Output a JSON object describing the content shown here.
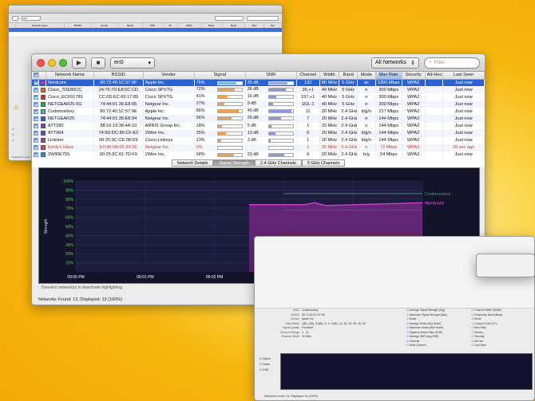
{
  "main": {
    "interface": "en0",
    "network_filter": "All Networks",
    "search_placeholder": "Filter",
    "columns": [
      "",
      "",
      "Network Name",
      "BSSID",
      "Vendor",
      "Signal",
      "SNR",
      "Channel",
      "Width",
      "Band",
      "Mode",
      "Max Rate",
      "Security",
      "Ad-Hoc",
      "Last Seen"
    ],
    "networks": [
      {
        "name": "Nerdcore",
        "bssid": "90:72:40:1C:57:9F",
        "vendor": "Apple Inc.",
        "signal": "76%",
        "signal_level": 0.76,
        "snr": "39 dB",
        "snr_level": 0.78,
        "channel": "132",
        "width": "80 MHz",
        "band": "5 GHz",
        "mode": "ac",
        "max_rate": "1300 Mbps",
        "security": "WPA2",
        "adhoc": "",
        "last_seen": "Just now",
        "color": "#c030c0",
        "selected": true,
        "red": false
      },
      {
        "name": "Cisco_7DE80CC",
        "bssid": "24:76:7D:E8:0C:CD",
        "vendor": "Cisco SPVTG",
        "signal": "72%",
        "signal_level": 0.72,
        "snr": "36 dB",
        "snr_level": 0.72,
        "channel": "36,+1",
        "width": "40 MHz",
        "band": "5 GHz",
        "mode": "n",
        "max_rate": "300 Mbps",
        "security": "WPA2",
        "adhoc": "",
        "last_seen": "Just now",
        "color": "#e07020",
        "selected": false,
        "red": false
      },
      {
        "name": "Cisco_EC691789",
        "bssid": "CC:0D:EC:69:17:89",
        "vendor": "Cisco SPVTG",
        "signal": "41%",
        "signal_level": 0.41,
        "snr": "16 dB",
        "snr_level": 0.32,
        "channel": "157,+1",
        "width": "40 MHz",
        "band": "5 GHz",
        "mode": "n",
        "max_rate": "300 Mbps",
        "security": "WPA2",
        "adhoc": "",
        "last_seen": "Just now",
        "color": "#d03030",
        "selected": false,
        "red": false
      },
      {
        "name": "NETGEAR25-5G",
        "bssid": "74:44:01:36:E8:95",
        "vendor": "Netgear Inc.",
        "signal": "27%",
        "signal_level": 0.27,
        "snr": "9 dB",
        "snr_level": 0.18,
        "channel": "153,-1",
        "width": "40 MHz",
        "band": "5 GHz",
        "mode": "n",
        "max_rate": "300 Mbps",
        "security": "WPA2",
        "adhoc": "",
        "last_seen": "Just now",
        "color": "#30a040",
        "selected": false,
        "red": false
      },
      {
        "name": "Codemonkey",
        "bssid": "90:72:40:1C:57:9E",
        "vendor": "Apple Inc.",
        "signal": "86%",
        "signal_level": 0.86,
        "snr": "49 dB",
        "snr_level": 0.95,
        "channel": "11",
        "width": "20 MHz",
        "band": "2.4 GHz",
        "mode": "b/g/n",
        "max_rate": "217 Mbps",
        "security": "WPA2",
        "adhoc": "",
        "last_seen": "Just now",
        "color": "#40c0a0",
        "selected": false,
        "red": false
      },
      {
        "name": "NETGEAR25",
        "bssid": "74:44:01:36:E8:94",
        "vendor": "Netgear Inc.",
        "signal": "56%",
        "signal_level": 0.56,
        "snr": "25 dB",
        "snr_level": 0.5,
        "channel": "7",
        "width": "20 MHz",
        "band": "2.4 GHz",
        "mode": "n",
        "max_rate": "144 Mbps",
        "security": "WPA2",
        "adhoc": "",
        "last_seen": "Just now",
        "color": "#2060d0",
        "selected": false,
        "red": false
      },
      {
        "name": "ATT280",
        "bssid": "88:16:19:38:4A:10",
        "vendor": "ARRIS Group Inc.",
        "signal": "18%",
        "signal_level": 0.18,
        "snr": "5 dB",
        "snr_level": 0.1,
        "channel": "1",
        "width": "20 MHz",
        "band": "2.4 GHz",
        "mode": "n",
        "max_rate": "144 Mbps",
        "security": "WPA2",
        "adhoc": "",
        "last_seen": "Just now",
        "color": "#8040c0",
        "selected": false,
        "red": false
      },
      {
        "name": "ATT964",
        "bssid": "74:9D:DC:89:CF:E2",
        "vendor": "2Wire Inc.",
        "signal": "35%",
        "signal_level": 0.35,
        "snr": "13 dB",
        "snr_level": 0.26,
        "channel": "6",
        "width": "20 MHz",
        "band": "2.4 GHz",
        "mode": "b/g/n",
        "max_rate": "144 Mbps",
        "security": "WPA2",
        "adhoc": "",
        "last_seen": "Just now",
        "color": "#5050d0",
        "selected": false,
        "red": false
      },
      {
        "name": "Linkster",
        "bssid": "00:25:9C:CE:08:D9",
        "vendor": "Cisco-Linksys",
        "signal": "13%",
        "signal_level": 0.13,
        "snr": "3 dB",
        "snr_level": 0.06,
        "channel": "1",
        "width": "20 MHz",
        "band": "2.4 GHz",
        "mode": "b/g/n",
        "max_rate": "144 Mbps",
        "security": "WPA2",
        "adhoc": "",
        "last_seen": "Just now",
        "color": "#a040a0",
        "selected": false,
        "red": false
      },
      {
        "name": "Emily's Haus",
        "bssid": "E0:46:9A:65:34:2E",
        "vendor": "Netgear Inc.",
        "signal": "0%",
        "signal_level": 0.0,
        "snr": "",
        "snr_level": 0.0,
        "channel": "1",
        "width": "20 MHz",
        "band": "2.4 GHz",
        "mode": "n",
        "max_rate": "72 Mbps",
        "security": "WPA2",
        "adhoc": "",
        "last_seen": "30 sec ago",
        "color": "#d04060",
        "selected": false,
        "red": true
      },
      {
        "name": "2WIRE755",
        "bssid": "00:25:3C:61:7D:F9",
        "vendor": "2Wire Inc.",
        "signal": "68%",
        "signal_level": 0.68,
        "snr": "33 dB",
        "snr_level": 0.66,
        "channel": "6",
        "width": "20 MHz",
        "band": "2.4 GHz",
        "mode": "b/g",
        "max_rate": "54 Mbps",
        "security": "WPA2",
        "adhoc": "",
        "last_seen": "Just now",
        "color": "#3090d0",
        "selected": false,
        "red": false
      }
    ],
    "tabs": [
      "Network Details",
      "Signal Strength",
      "2.4 GHz Channels",
      "5 GHz Channels"
    ],
    "active_tab": "Signal Strength",
    "hint": "Deselect network(s) to deactivate highlighting.",
    "status": "Networks Found: 13, Displayed: 13 (100%)"
  },
  "chart_data": {
    "type": "line",
    "ylabel": "Strength",
    "y_ticks": [
      "100%",
      "90%",
      "80%",
      "70%",
      "60%",
      "50%",
      "40%",
      "30%",
      "20%",
      "10%"
    ],
    "x_ticks": [
      "09:00 PM",
      "09:01 PM",
      "09:02 PM",
      "09:03 PM",
      "09:04 PM",
      "Now"
    ],
    "ylim": [
      0,
      100
    ],
    "legend_visible": [
      "Codemonkey",
      "Nerdcore"
    ],
    "highlighted_series": "Nerdcore",
    "series": [
      {
        "name": "Codemonkey",
        "color": "#5e8a8a",
        "points": [
          [
            3.0,
            86
          ],
          [
            5.0,
            86
          ]
        ]
      },
      {
        "name": "Nerdcore",
        "color": "#d040d0",
        "points": [
          [
            2.5,
            74
          ],
          [
            3.3,
            74
          ],
          [
            3.45,
            76
          ],
          [
            3.6,
            73
          ],
          [
            5.0,
            76
          ]
        ]
      },
      {
        "name": "2WIRE755",
        "color": "#3a6a8a",
        "points": [
          [
            3.0,
            68
          ],
          [
            5.0,
            68
          ]
        ]
      },
      {
        "name": "NETGEAR25",
        "color": "#35508a",
        "points": [
          [
            3.0,
            56
          ],
          [
            5.0,
            56
          ]
        ]
      },
      {
        "name": "Cisco_EC691789",
        "color": "#8a3040",
        "points": [
          [
            3.0,
            41
          ],
          [
            5.0,
            41
          ]
        ]
      },
      {
        "name": "ATT964",
        "color": "#40407a",
        "points": [
          [
            3.0,
            35
          ],
          [
            5.0,
            35
          ]
        ]
      },
      {
        "name": "NETGEAR25-5G",
        "color": "#3a6a3a",
        "points": [
          [
            3.0,
            27
          ],
          [
            5.0,
            27
          ]
        ]
      },
      {
        "name": "ATT280",
        "color": "#5a3a8a",
        "points": [
          [
            3.0,
            18
          ],
          [
            5.0,
            18
          ]
        ]
      }
    ]
  },
  "back_window": {
    "interface": "en0",
    "footer": "Networks Found: 13, Displayed: 13 (100%)"
  },
  "front_window": {
    "fields": [
      {
        "k": "SSID",
        "v": "Codemonkey"
      },
      {
        "k": "BSSID",
        "v": "90:72:40:1C:57:9E"
      },
      {
        "k": "Vendor",
        "v": "Apple Inc."
      },
      {
        "k": "Data Rates",
        "v": "1(B), 2(B), 5.5(B), 6, 9, 11(B), 12, 18, 24, 36, 48, 54"
      },
      {
        "k": "Signal Quality",
        "v": "Excellent"
      },
      {
        "k": "Channel Range",
        "v": "1 - 11"
      },
      {
        "k": "Channel Width",
        "v": "20 MHz"
      }
    ],
    "options": [
      "Average Signal Strength (Avg)",
      "Maximum Signal Strength (Max)",
      "Noise",
      "Average Noise (Avg Noise)",
      "Maximum Noise (Max Noise)",
      "Signal-to-Noise Ratio (SNR)",
      "Average SNR (Avg SNR)",
      "Channel",
      "Wide Channel",
      "Channel Width (Width)",
      "Frequency Band (Band)",
      "Mode",
      "Country Code (CC)",
      "Max Rate",
      "Vendor",
      "Security",
      "Ad-Hoc",
      "Last Seen"
    ],
    "side": [
      "Signal",
      "Noise",
      "SNR"
    ],
    "footer": "Networks Found: 14, Displayed: 14 (100%)"
  }
}
